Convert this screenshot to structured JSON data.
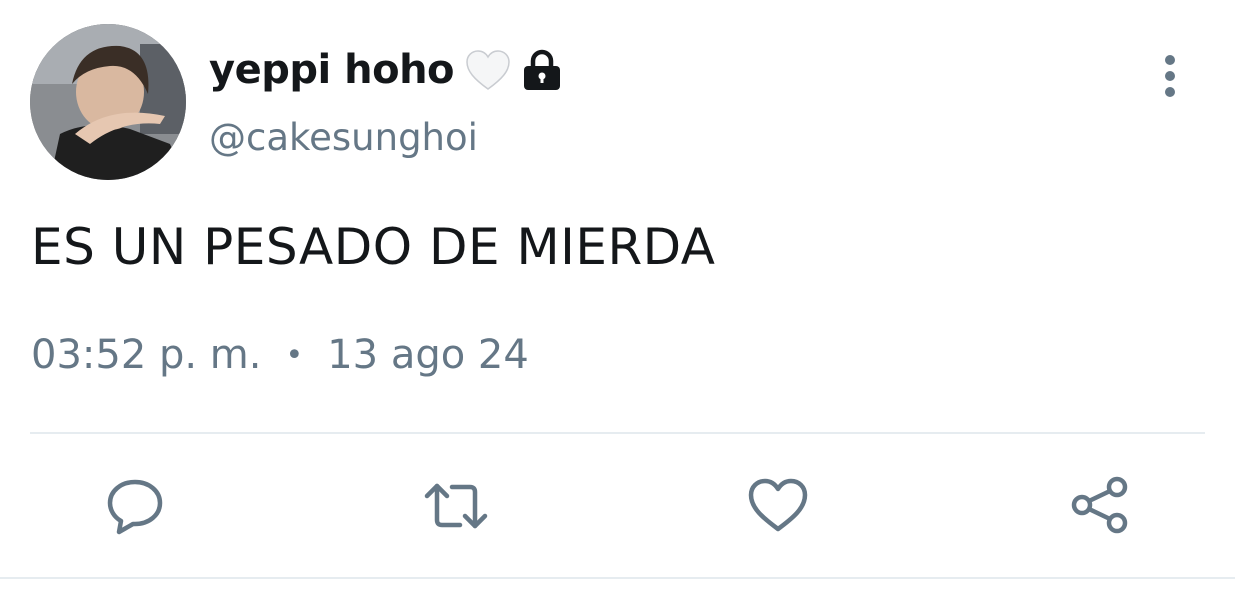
{
  "tweet": {
    "author": {
      "display_name": "yeppi hoho",
      "handle": "@cakesunghoi",
      "avatar_icon": "profile-photo",
      "name_emoji": "white-heart-icon",
      "protected_icon": "lock-icon"
    },
    "text": "ES UN PESADO DE MIERDA",
    "time": "03:52 p. m.",
    "separator": "•",
    "date": "13 ago 24"
  },
  "actions": {
    "reply_icon": "reply-icon",
    "retweet_icon": "retweet-icon",
    "like_icon": "like-icon",
    "share_icon": "share-icon",
    "more_icon": "more-vertical-icon"
  },
  "colors": {
    "text_primary": "#14171a",
    "text_secondary": "#657786",
    "divider": "#e6ecf0"
  }
}
